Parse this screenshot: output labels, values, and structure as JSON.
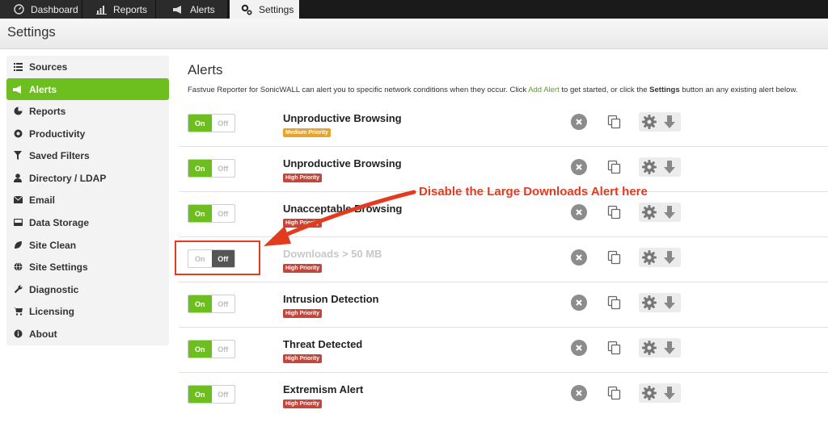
{
  "nav": {
    "tabs": [
      {
        "label": "Dashboard",
        "icon": "dashboard-gauge-icon"
      },
      {
        "label": "Reports",
        "icon": "bar-chart-icon"
      },
      {
        "label": "Alerts",
        "icon": "megaphone-icon"
      },
      {
        "label": "Settings",
        "icon": "gears-icon",
        "active": true
      }
    ]
  },
  "header": {
    "title": "Settings"
  },
  "sidebar": {
    "items": [
      {
        "label": "Sources",
        "icon": "list-icon"
      },
      {
        "label": "Alerts",
        "icon": "megaphone-icon",
        "active": true
      },
      {
        "label": "Reports",
        "icon": "pie-chart-icon"
      },
      {
        "label": "Productivity",
        "icon": "target-icon"
      },
      {
        "label": "Saved Filters",
        "icon": "filter-icon"
      },
      {
        "label": "Directory / LDAP",
        "icon": "user-icon"
      },
      {
        "label": "Email",
        "icon": "envelope-icon"
      },
      {
        "label": "Data Storage",
        "icon": "hard-drive-icon"
      },
      {
        "label": "Site Clean",
        "icon": "leaf-icon"
      },
      {
        "label": "Site Settings",
        "icon": "globe-icon"
      },
      {
        "label": "Diagnostic",
        "icon": "wrench-icon"
      },
      {
        "label": "Licensing",
        "icon": "cart-icon"
      },
      {
        "label": "About",
        "icon": "info-icon"
      }
    ]
  },
  "main": {
    "title": "Alerts",
    "intro_before": "Fastvue Reporter for SonicWALL can alert you to specific network conditions when they occur. Click ",
    "intro_link": "Add Alert",
    "intro_middle": " to get started, or click the ",
    "intro_bold": "Settings",
    "intro_after": " button an any existing alert below.",
    "toggle_on_label": "On",
    "toggle_off_label": "Off",
    "alerts": [
      {
        "name": "Unproductive Browsing",
        "priority": "Medium Priority",
        "priority_color": "#e8a32a",
        "enabled": true
      },
      {
        "name": "Unproductive Browsing",
        "priority": "High Priority",
        "priority_color": "#c0473c",
        "enabled": true
      },
      {
        "name": "Unacceptable Browsing",
        "priority": "High Priority",
        "priority_color": "#c0473c",
        "enabled": true
      },
      {
        "name": "Downloads > 50 MB",
        "priority": "High Priority",
        "priority_color": "#c0473c",
        "enabled": false
      },
      {
        "name": "Intrusion Detection",
        "priority": "High Priority",
        "priority_color": "#c0473c",
        "enabled": true
      },
      {
        "name": "Threat Detected",
        "priority": "High Priority",
        "priority_color": "#c0473c",
        "enabled": true
      },
      {
        "name": "Extremism Alert",
        "priority": "High Priority",
        "priority_color": "#c0473c",
        "enabled": true
      }
    ]
  },
  "annotation": {
    "text": "Disable the Large Downloads Alert here",
    "color": "#e33b1e"
  },
  "colors": {
    "accent_green": "#6cbf1e",
    "link_green": "#5aa616"
  }
}
